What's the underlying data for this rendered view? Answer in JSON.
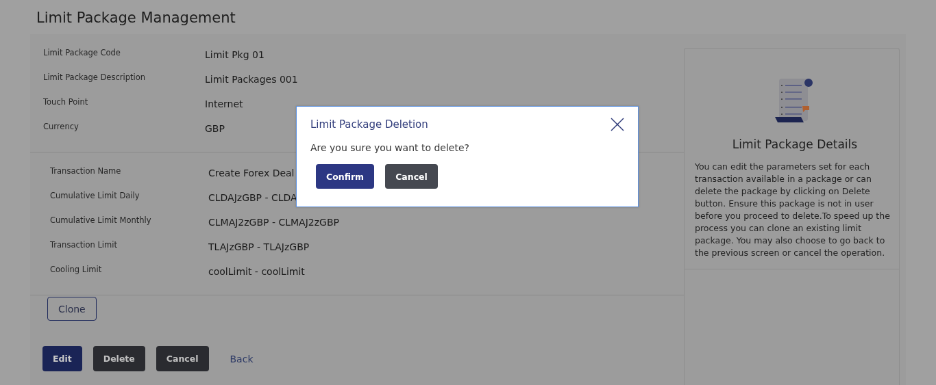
{
  "page_title": "Limit Package Management",
  "package_fields": [
    {
      "label": "Limit Package Code",
      "value": "Limit Pkg 01"
    },
    {
      "label": "Limit Package Description",
      "value": "Limit Packages 001"
    },
    {
      "label": "Touch Point",
      "value": "Internet"
    },
    {
      "label": "Currency",
      "value": "GBP"
    }
  ],
  "transaction_fields": [
    {
      "label": "Transaction Name",
      "value": "Create Forex Deal"
    },
    {
      "label": "Cumulative Limit Daily",
      "value": "CLDAJzGBP - CLDA"
    },
    {
      "label": "Cumulative Limit Monthly",
      "value": "CLMAJ2zGBP - CLMAJ2zGBP"
    },
    {
      "label": "Transaction Limit",
      "value": "TLAJzGBP - TLAJzGBP"
    },
    {
      "label": "Cooling Limit",
      "value": "coolLimit - coolLimit"
    }
  ],
  "clone_button": "Clone",
  "actions": [
    {
      "label": "Edit",
      "kind": "primary"
    },
    {
      "label": "Delete",
      "kind": "dark"
    },
    {
      "label": "Cancel",
      "kind": "dark"
    },
    {
      "label": "Back",
      "kind": "link"
    }
  ],
  "info_card": {
    "title": "Limit Package Details",
    "text": "You can edit the parameters set for each transaction available in a package or can delete the package by clicking on Delete button. Ensure this package is not in user before you proceed to delete.To speed up the process you can clone an existing limit package. You may also choose to go back to the previous screen or cancel the operation."
  },
  "dialog": {
    "title": "Limit Package Deletion",
    "message": "Are you sure you want to delete?",
    "buttons": [
      {
        "label": "Confirm",
        "kind": "primary"
      },
      {
        "label": "Cancel",
        "kind": "dark"
      }
    ]
  }
}
